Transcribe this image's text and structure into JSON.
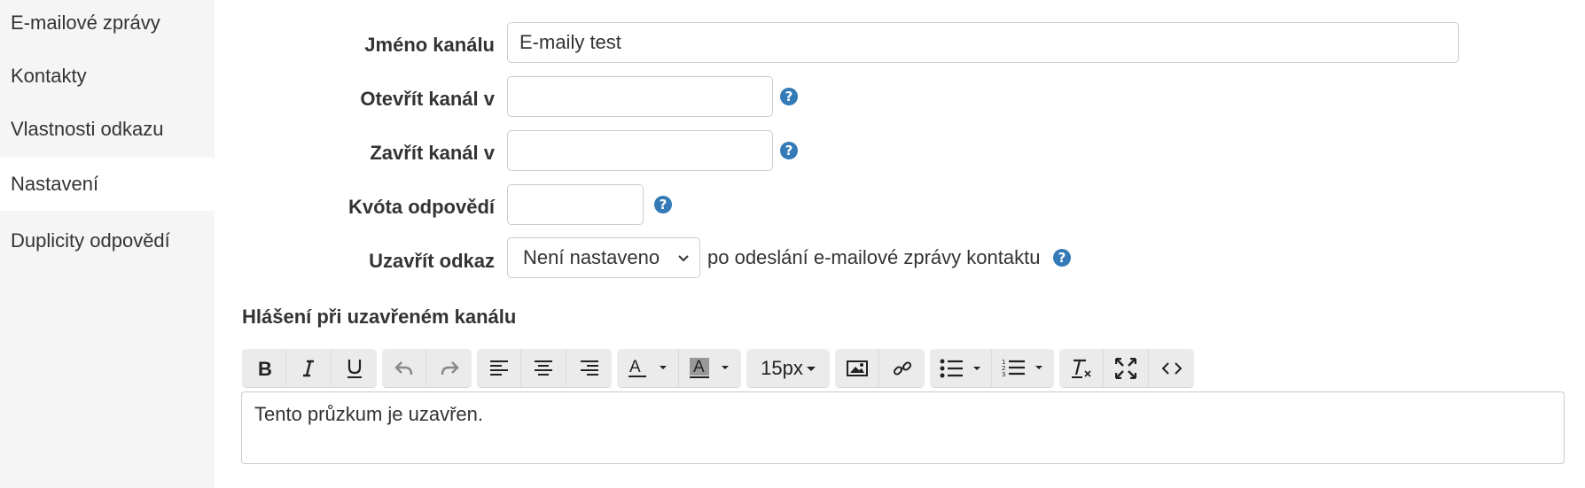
{
  "sidebar": {
    "items": [
      {
        "label": "E-mailové zprávy",
        "active": false
      },
      {
        "label": "Kontakty",
        "active": false
      },
      {
        "label": "Vlastnosti odkazu",
        "active": false
      },
      {
        "label": "Nastavení",
        "active": true
      },
      {
        "label": "Duplicity odpovědí",
        "active": false
      }
    ]
  },
  "form": {
    "channel_name_label": "Jméno kanálu",
    "channel_name_value": "E-maily test",
    "open_label": "Otevřít kanál v",
    "open_value": "",
    "close_label": "Zavřít kanál v",
    "close_value": "",
    "quota_label": "Kvóta odpovědí",
    "quota_value": "",
    "close_link_label": "Uzavřít odkaz",
    "close_link_selected": "Není nastaveno",
    "close_link_suffix": "po odeslání e-mailové zprávy kontaktu",
    "help_glyph": "?"
  },
  "closed_message": {
    "title": "Hlášení při uzavřeném kanálu",
    "content": "Tento průzkum je uzavřen."
  },
  "toolbar": {
    "font_size": "15px",
    "icons": [
      "bold-icon",
      "italic-icon",
      "underline-icon",
      "undo-icon",
      "redo-icon",
      "align-left-icon",
      "align-center-icon",
      "align-right-icon",
      "font-color-icon",
      "highlight-color-icon",
      "font-size-dropdown",
      "image-icon",
      "link-icon",
      "bullet-list-icon",
      "numbered-list-icon",
      "clear-format-icon",
      "fullscreen-icon",
      "code-view-icon"
    ]
  },
  "colors": {
    "sidebar_bg": "#f5f5f5",
    "help_icon": "#337ab7",
    "toolbar_bg": "#ebebeb",
    "text": "#333333"
  }
}
